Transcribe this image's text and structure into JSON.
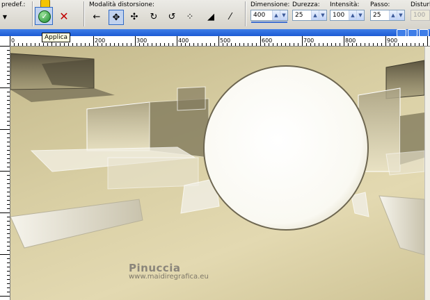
{
  "toolbar": {
    "preset_label": "predef.:",
    "mode_label": "Modalità distorsione:",
    "size_label": "Dimensione:",
    "size_value": "400",
    "hardness_label": "Durezza:",
    "hardness_value": "25",
    "intensity_label": "Intensità:",
    "intensity_value": "100",
    "step_label": "Passo:",
    "step_value": "25",
    "noise_label": "Disturb",
    "noise_value": "100"
  },
  "tooltip": {
    "text": "Applica"
  },
  "ruler": {
    "top": [
      "0",
      "100",
      "200",
      "300",
      "400",
      "500",
      "600",
      "700",
      "800",
      "900"
    ]
  },
  "watermark": {
    "name": "Pinuccia",
    "site": "www.maidiregrafica.eu"
  },
  "colors": {
    "selection": "#316ac5",
    "canvas": "#d8cea3",
    "titlebar": "#1c5bd4"
  }
}
